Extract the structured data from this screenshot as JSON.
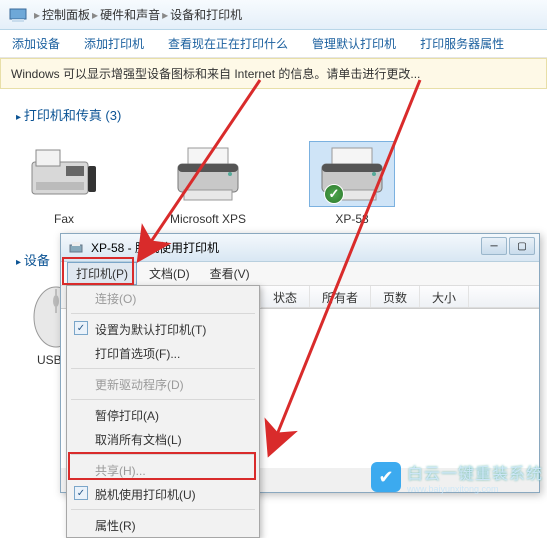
{
  "nav": {
    "breadcrumb": [
      "控制面板",
      "硬件和声音",
      "设备和打印机"
    ]
  },
  "tabs": {
    "add_device": "添加设备",
    "add_printer": "添加打印机",
    "see_printing": "查看现在正在打印什么",
    "manage_default": "管理默认打印机",
    "server_props": "打印服务器属性"
  },
  "info_bar": "Windows 可以显示增强型设备图标和来自 Internet 的信息。请单击进行更改...",
  "sections": {
    "printers_title": "打印机和传真 (3)",
    "devices_title": "设备"
  },
  "devices": {
    "fax": "Fax",
    "xps": "Microsoft XPS",
    "xp58": "XP-58",
    "usb": "USB M"
  },
  "queue": {
    "title": "XP-58 - 脱机使用打印机",
    "menus": {
      "printer": "打印机(P)",
      "document": "文档(D)",
      "view": "查看(V)"
    },
    "headers": {
      "status": "状态",
      "owner": "所有者",
      "pages": "页数",
      "size": "大小"
    }
  },
  "dropdown": {
    "connect": "连接(O)",
    "set_default": "设置为默认打印机(T)",
    "preferences": "打印首选项(F)...",
    "update_driver": "更新驱动程序(D)",
    "pause": "暂停打印(A)",
    "cancel_all": "取消所有文档(L)",
    "share": "共享(H)...",
    "offline": "脱机使用打印机(U)",
    "properties": "属性(R)"
  },
  "watermark": {
    "main": "白云一键重装系统",
    "sub": "www.baiyunxitong.com"
  }
}
